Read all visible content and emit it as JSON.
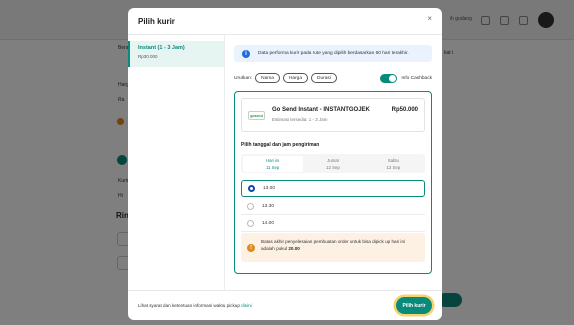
{
  "background": {
    "top_right_text": "ih gudang",
    "left_labels": [
      "Berat",
      "Harga",
      "Ra",
      "Kurir",
      "Hi"
    ],
    "right_label": "kat i",
    "heading": "Rin"
  },
  "modal": {
    "title": "Pilih kurir",
    "close_glyph": "×",
    "sidebar": {
      "items": [
        {
          "title": "Instant (1 - 3 Jam)",
          "price": "Rp30.000"
        }
      ]
    },
    "info_banner": "Data performa kurir pada rute yang dipilih berdasarkan 60 hari terakhir.",
    "sort": {
      "label": "Urutkan:",
      "options": [
        "Nama",
        "Harga",
        "Durasi"
      ],
      "cashback_label": "Info Cashback",
      "cashback_on": true
    },
    "service": {
      "logo_text": "gosend",
      "name": "Go Send Instant - INSTANTGOJEK",
      "eta": "Estimasi tersedia: 1 - 3 Jam",
      "price": "Rp50.000"
    },
    "date_heading": "Pilih tanggal dan jam pengiriman",
    "date_tabs": [
      {
        "day": "Hari ini",
        "date": "11 Sep",
        "active": true
      },
      {
        "day": "Jumat",
        "date": "12 Sep",
        "active": false
      },
      {
        "day": "Sabtu",
        "date": "13 Sep",
        "active": false
      }
    ],
    "time_options": [
      {
        "label": "13.00",
        "selected": true
      },
      {
        "label": "13.30",
        "selected": false
      },
      {
        "label": "14.00",
        "selected": false
      }
    ],
    "warning": {
      "text": "Batas akhir penyelesaian pembuatan order untuk bisa dipick up hari ini adalah pukul",
      "time": "20.00"
    },
    "footer": {
      "text": "Lihat syarat dan ketentuan informasi waktu pickup",
      "link": "disini"
    },
    "choose_button": "Pilih kurir"
  },
  "colors": {
    "primary": "#0a8a7a",
    "info": "#1e6ee0",
    "warning": "#e08a1e",
    "highlight": "#f4d36a"
  }
}
